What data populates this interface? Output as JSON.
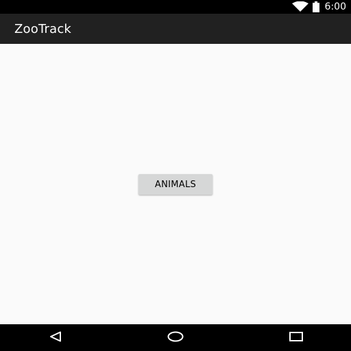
{
  "status_bar": {
    "time": "6:00",
    "icons": [
      "wifi-icon",
      "battery-icon"
    ]
  },
  "app_bar": {
    "title": "ZooTrack"
  },
  "main": {
    "animals_button_label": "ANIMALS"
  },
  "nav_bar": {
    "buttons": [
      "back-icon",
      "home-icon",
      "recents-icon"
    ]
  },
  "colors": {
    "status_bar": "#000000",
    "app_bar": "#212121",
    "background": "#fafafa",
    "button": "#d6d7d7",
    "nav_bar": "#000000"
  }
}
